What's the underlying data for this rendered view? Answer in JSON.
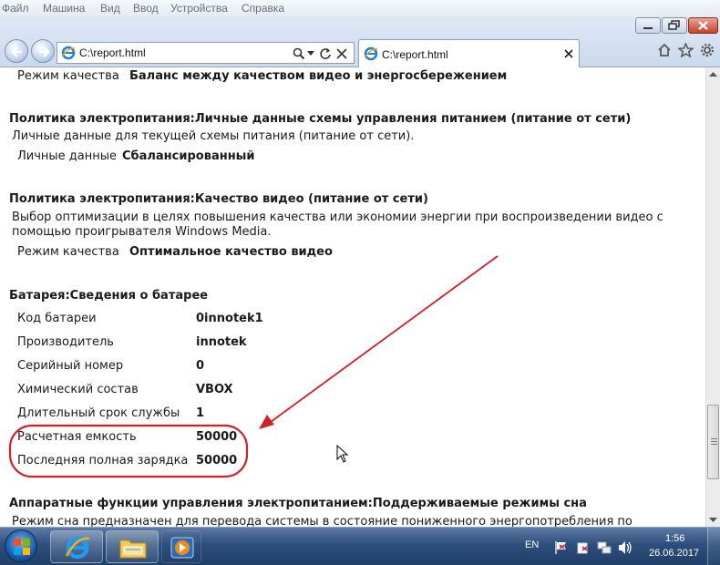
{
  "menu": [
    "Файл",
    "Машина",
    "Вид",
    "Ввод",
    "Устройства",
    "Справка"
  ],
  "address_bar": {
    "url": "C:\\report.html"
  },
  "tab": {
    "title": "C:\\report.html"
  },
  "top_row": {
    "label": "Режим качества",
    "value": "Баланс между качеством видео и энергосбережением"
  },
  "sections": [
    {
      "heading": "Политика электропитания:Личные данные схемы управления питанием (питание от сети)",
      "description": [
        "Личные данные для текущей схемы питания (питание от сети)."
      ],
      "rows": [
        {
          "label": "Личные данные",
          "value": "Сбалансированный"
        }
      ]
    },
    {
      "heading": "Политика электропитания:Качество видео (питание от сети)",
      "description": [
        "Выбор оптимизации в целях повышения качества или экономии энергии при воспроизведении видео с",
        "помощью проигрывателя Windows Media."
      ],
      "rows": [
        {
          "label": "Режим качества",
          "value": "Оптимальное качество видео"
        }
      ]
    },
    {
      "heading": "Батарея:Сведения о батарее",
      "rows": [
        {
          "label": "Код батареи",
          "value": "0innotek1"
        },
        {
          "label": "Производитель",
          "value": "innotek"
        },
        {
          "label": "Серийный номер",
          "value": "0"
        },
        {
          "label": "Химический состав",
          "value": "VBOX"
        },
        {
          "label": "Длительный срок службы",
          "value": "1"
        },
        {
          "label": "Расчетная емкость",
          "value": "50000"
        },
        {
          "label": "Последняя полная зарядка",
          "value": "50000"
        }
      ]
    },
    {
      "heading": "Аппаратные функции управления электропитанием:Поддерживаемые режимы сна",
      "description": [
        "Режим сна предназначен для перевода системы в состояние пониженного энергопотребления по"
      ]
    }
  ],
  "annotation": {
    "color": "#d21f2a"
  },
  "taskbar": {
    "language": "EN",
    "time": "1:56",
    "date": "26.06.2017"
  },
  "colors": {
    "accent": "#2d4f7c",
    "ie_blue": "#1f7fd4"
  }
}
